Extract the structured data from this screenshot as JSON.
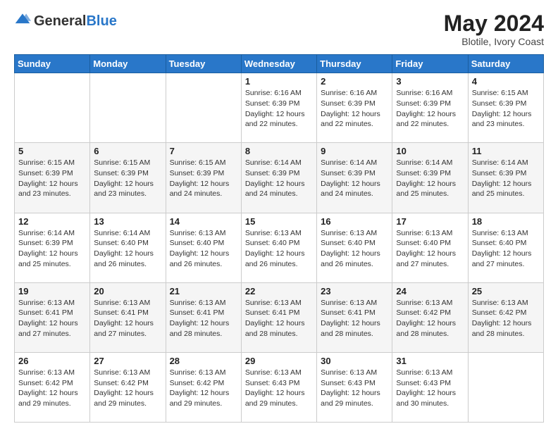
{
  "header": {
    "logo_general": "General",
    "logo_blue": "Blue",
    "month_title": "May 2024",
    "location": "Blotile, Ivory Coast"
  },
  "days_of_week": [
    "Sunday",
    "Monday",
    "Tuesday",
    "Wednesday",
    "Thursday",
    "Friday",
    "Saturday"
  ],
  "weeks": [
    [
      {
        "day": "",
        "info": ""
      },
      {
        "day": "",
        "info": ""
      },
      {
        "day": "",
        "info": ""
      },
      {
        "day": "1",
        "info": "Sunrise: 6:16 AM\nSunset: 6:39 PM\nDaylight: 12 hours\nand 22 minutes."
      },
      {
        "day": "2",
        "info": "Sunrise: 6:16 AM\nSunset: 6:39 PM\nDaylight: 12 hours\nand 22 minutes."
      },
      {
        "day": "3",
        "info": "Sunrise: 6:16 AM\nSunset: 6:39 PM\nDaylight: 12 hours\nand 22 minutes."
      },
      {
        "day": "4",
        "info": "Sunrise: 6:15 AM\nSunset: 6:39 PM\nDaylight: 12 hours\nand 23 minutes."
      }
    ],
    [
      {
        "day": "5",
        "info": "Sunrise: 6:15 AM\nSunset: 6:39 PM\nDaylight: 12 hours\nand 23 minutes."
      },
      {
        "day": "6",
        "info": "Sunrise: 6:15 AM\nSunset: 6:39 PM\nDaylight: 12 hours\nand 23 minutes."
      },
      {
        "day": "7",
        "info": "Sunrise: 6:15 AM\nSunset: 6:39 PM\nDaylight: 12 hours\nand 24 minutes."
      },
      {
        "day": "8",
        "info": "Sunrise: 6:14 AM\nSunset: 6:39 PM\nDaylight: 12 hours\nand 24 minutes."
      },
      {
        "day": "9",
        "info": "Sunrise: 6:14 AM\nSunset: 6:39 PM\nDaylight: 12 hours\nand 24 minutes."
      },
      {
        "day": "10",
        "info": "Sunrise: 6:14 AM\nSunset: 6:39 PM\nDaylight: 12 hours\nand 25 minutes."
      },
      {
        "day": "11",
        "info": "Sunrise: 6:14 AM\nSunset: 6:39 PM\nDaylight: 12 hours\nand 25 minutes."
      }
    ],
    [
      {
        "day": "12",
        "info": "Sunrise: 6:14 AM\nSunset: 6:39 PM\nDaylight: 12 hours\nand 25 minutes."
      },
      {
        "day": "13",
        "info": "Sunrise: 6:14 AM\nSunset: 6:40 PM\nDaylight: 12 hours\nand 26 minutes."
      },
      {
        "day": "14",
        "info": "Sunrise: 6:13 AM\nSunset: 6:40 PM\nDaylight: 12 hours\nand 26 minutes."
      },
      {
        "day": "15",
        "info": "Sunrise: 6:13 AM\nSunset: 6:40 PM\nDaylight: 12 hours\nand 26 minutes."
      },
      {
        "day": "16",
        "info": "Sunrise: 6:13 AM\nSunset: 6:40 PM\nDaylight: 12 hours\nand 26 minutes."
      },
      {
        "day": "17",
        "info": "Sunrise: 6:13 AM\nSunset: 6:40 PM\nDaylight: 12 hours\nand 27 minutes."
      },
      {
        "day": "18",
        "info": "Sunrise: 6:13 AM\nSunset: 6:40 PM\nDaylight: 12 hours\nand 27 minutes."
      }
    ],
    [
      {
        "day": "19",
        "info": "Sunrise: 6:13 AM\nSunset: 6:41 PM\nDaylight: 12 hours\nand 27 minutes."
      },
      {
        "day": "20",
        "info": "Sunrise: 6:13 AM\nSunset: 6:41 PM\nDaylight: 12 hours\nand 27 minutes."
      },
      {
        "day": "21",
        "info": "Sunrise: 6:13 AM\nSunset: 6:41 PM\nDaylight: 12 hours\nand 28 minutes."
      },
      {
        "day": "22",
        "info": "Sunrise: 6:13 AM\nSunset: 6:41 PM\nDaylight: 12 hours\nand 28 minutes."
      },
      {
        "day": "23",
        "info": "Sunrise: 6:13 AM\nSunset: 6:41 PM\nDaylight: 12 hours\nand 28 minutes."
      },
      {
        "day": "24",
        "info": "Sunrise: 6:13 AM\nSunset: 6:42 PM\nDaylight: 12 hours\nand 28 minutes."
      },
      {
        "day": "25",
        "info": "Sunrise: 6:13 AM\nSunset: 6:42 PM\nDaylight: 12 hours\nand 28 minutes."
      }
    ],
    [
      {
        "day": "26",
        "info": "Sunrise: 6:13 AM\nSunset: 6:42 PM\nDaylight: 12 hours\nand 29 minutes."
      },
      {
        "day": "27",
        "info": "Sunrise: 6:13 AM\nSunset: 6:42 PM\nDaylight: 12 hours\nand 29 minutes."
      },
      {
        "day": "28",
        "info": "Sunrise: 6:13 AM\nSunset: 6:42 PM\nDaylight: 12 hours\nand 29 minutes."
      },
      {
        "day": "29",
        "info": "Sunrise: 6:13 AM\nSunset: 6:43 PM\nDaylight: 12 hours\nand 29 minutes."
      },
      {
        "day": "30",
        "info": "Sunrise: 6:13 AM\nSunset: 6:43 PM\nDaylight: 12 hours\nand 29 minutes."
      },
      {
        "day": "31",
        "info": "Sunrise: 6:13 AM\nSunset: 6:43 PM\nDaylight: 12 hours\nand 30 minutes."
      },
      {
        "day": "",
        "info": ""
      }
    ]
  ]
}
